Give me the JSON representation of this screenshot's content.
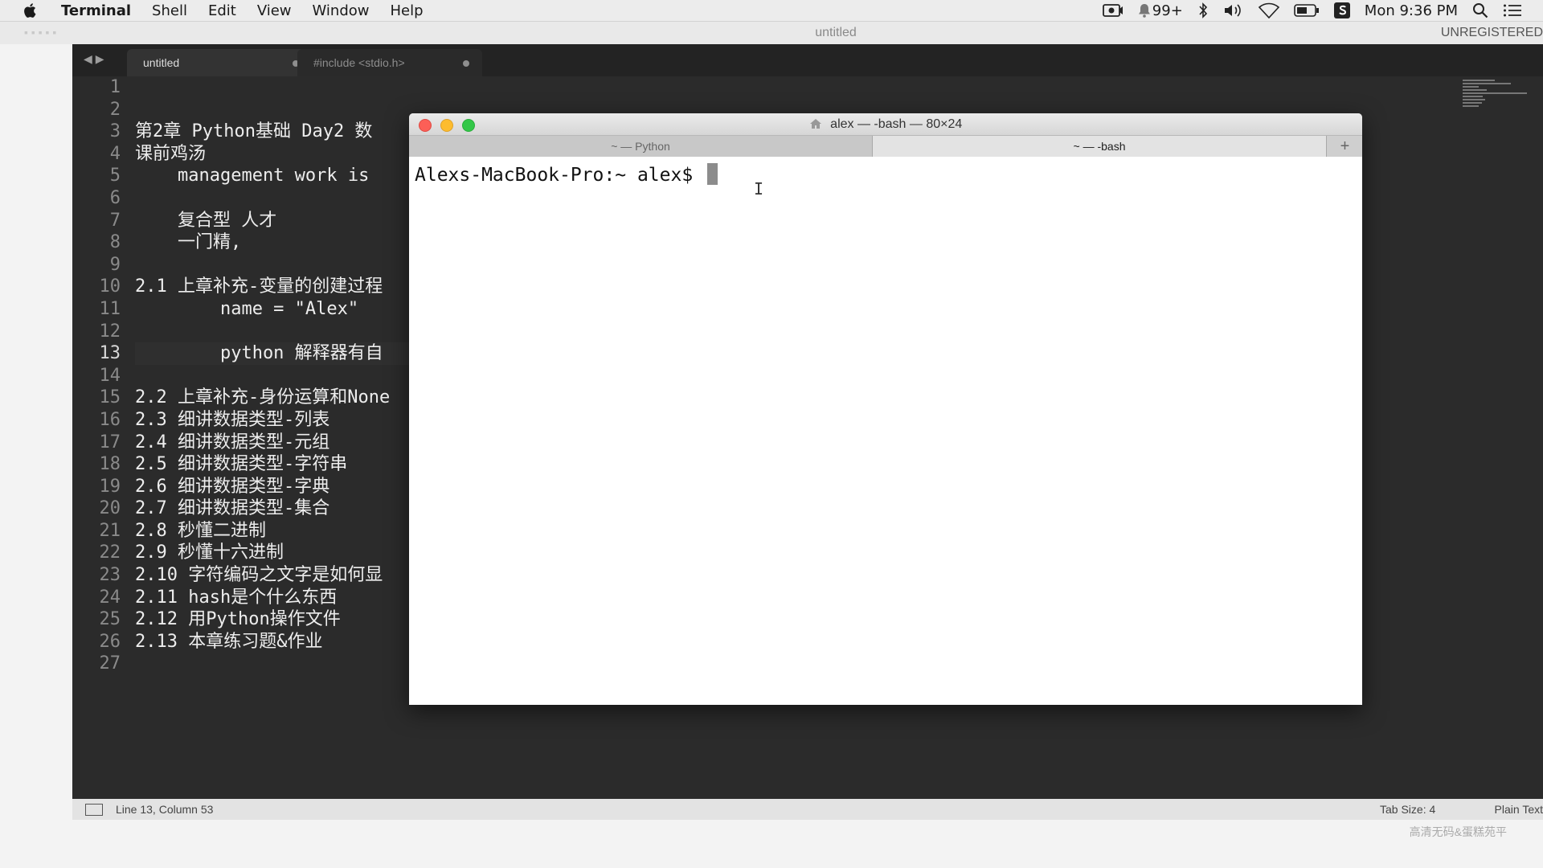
{
  "menubar": {
    "app_name": "Terminal",
    "items": [
      "Shell",
      "Edit",
      "View",
      "Window",
      "Help"
    ],
    "notification_count": "99+",
    "clock": "Mon 9:36 PM"
  },
  "editor": {
    "window_title": "untitled",
    "license_label": "UNREGISTERED",
    "tabs": [
      {
        "label": "untitled"
      },
      {
        "label": "#include <stdio.h>"
      }
    ],
    "line_numbers": [
      "1",
      "2",
      "3",
      "4",
      "5",
      "6",
      "7",
      "8",
      "9",
      "10",
      "11",
      "12",
      "13",
      "14",
      "15",
      "16",
      "17",
      "18",
      "19",
      "20",
      "21",
      "22",
      "23",
      "24",
      "25",
      "26",
      "27"
    ],
    "lines": [
      "",
      "",
      "第2章 Python基础 Day2 数",
      "课前鸡汤",
      "    management work is",
      "",
      "    复合型 人才",
      "    一门精,",
      "",
      "2.1 上章补充-变量的创建过程",
      "        name = \"Alex\"",
      "",
      "        python 解释器有自",
      "",
      "2.2 上章补充-身份运算和None",
      "2.3 细讲数据类型-列表",
      "2.4 细讲数据类型-元组",
      "2.5 细讲数据类型-字符串",
      "2.6 细讲数据类型-字典",
      "2.7 细讲数据类型-集合",
      "2.8 秒懂二进制",
      "2.9 秒懂十六进制",
      "2.10 字符编码之文字是如何显",
      "2.11 hash是个什么东西",
      "2.12 用Python操作文件",
      "2.13 本章练习题&作业",
      ""
    ],
    "status": {
      "position": "Line 13, Column 53",
      "tab_size": "Tab Size: 4",
      "syntax": "Plain Text"
    }
  },
  "terminal": {
    "title": "alex — -bash — 80×24",
    "tabs": [
      {
        "label": "~ — Python"
      },
      {
        "label": "~ — -bash"
      }
    ],
    "new_tab_label": "+",
    "prompt": "Alexs-MacBook-Pro:~ alex$ "
  },
  "icons": [
    "apple-icon",
    "camera-icon",
    "notification-icon",
    "bluetooth-icon",
    "volume-icon",
    "wifi-icon",
    "battery-icon",
    "sogou-icon",
    "search-icon",
    "list-icon",
    "house-icon"
  ],
  "watermark": "高清无码&蛋糕苑平"
}
